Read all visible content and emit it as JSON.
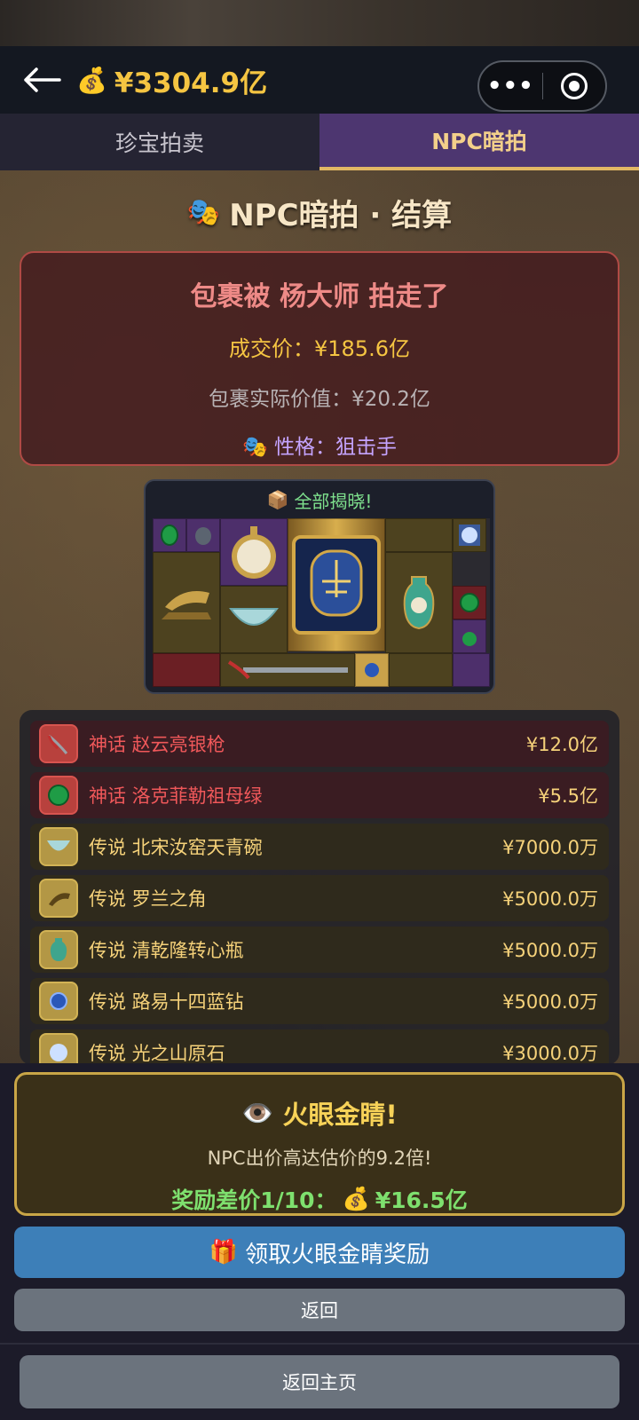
{
  "header": {
    "money_icon": "💰",
    "money": "¥3304.9亿",
    "menu_dots": "•••"
  },
  "tabs": [
    {
      "label": "珍宝拍卖",
      "active": false
    },
    {
      "label": "NPC暗拍",
      "active": true
    }
  ],
  "section": {
    "icon": "🎭",
    "title": "NPC暗拍 · 结算"
  },
  "result": {
    "title": "包裹被 杨大师 拍走了",
    "deal_price": "成交价：¥185.6亿",
    "actual_value": "包裹实际价值：¥20.2亿",
    "trait_icon": "🎭",
    "trait": "性格：狙击手"
  },
  "reveal": {
    "icon": "📦",
    "title": "全部揭晓!"
  },
  "items": [
    {
      "rarity": "神话",
      "name": "赵云亮银枪",
      "price": "¥12.0亿",
      "icon": "spear-icon"
    },
    {
      "rarity": "神话",
      "name": "洛克菲勒祖母绿",
      "price": "¥5.5亿",
      "icon": "emerald-icon"
    },
    {
      "rarity": "传说",
      "name": "北宋汝窑天青碗",
      "price": "¥7000.0万",
      "icon": "bowl-icon"
    },
    {
      "rarity": "传说",
      "name": "罗兰之角",
      "price": "¥5000.0万",
      "icon": "horn-icon"
    },
    {
      "rarity": "传说",
      "name": "清乾隆转心瓶",
      "price": "¥5000.0万",
      "icon": "vase-icon"
    },
    {
      "rarity": "传说",
      "name": "路易十四蓝钻",
      "price": "¥5000.0万",
      "icon": "blue-diamond-icon"
    },
    {
      "rarity": "传说",
      "name": "光之山原石",
      "price": "¥3000.0万",
      "icon": "gem-icon"
    }
  ],
  "items_text": [
    "神话 赵云亮银枪",
    "神话 洛克菲勒祖母绿",
    "传说 北宋汝窑天青碗",
    "传说 罗兰之角",
    "传说 清乾隆转心瓶",
    "传说 路易十四蓝钻",
    "传说 光之山原石"
  ],
  "eye": {
    "icon": "👁️",
    "title": "火眼金睛!",
    "desc": "NPC出价高达估价的9.2倍!",
    "reward_label": "奖励差价1/10：",
    "reward_icon": "💰",
    "reward_amount": "¥16.5亿"
  },
  "buttons": {
    "claim_icon": "🎁",
    "claim": "领取火眼金睛奖励",
    "back": "返回",
    "home": "返回主页"
  },
  "colors": {
    "accent_gold": "#f5c542",
    "myth_red": "#f0585a",
    "legend_gold": "#f6d27a",
    "active_tab": "#4d3670",
    "claim_blue": "#3d7fb8"
  }
}
